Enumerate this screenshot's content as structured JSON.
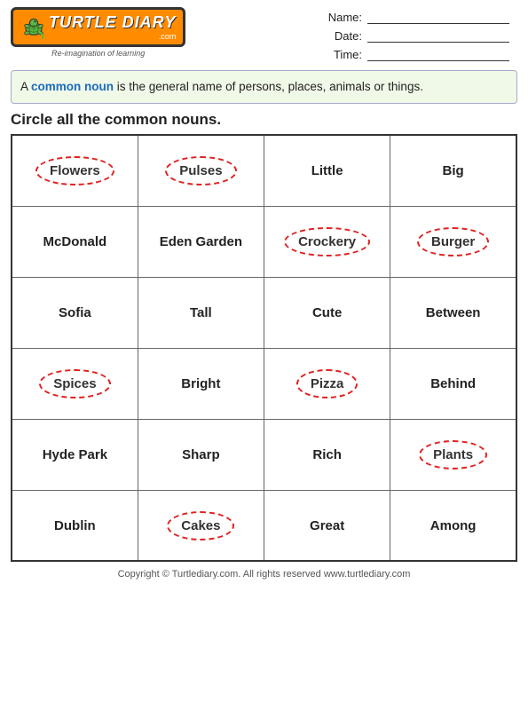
{
  "header": {
    "logo_title": "TURTLE DIARY",
    "logo_subtitle": ".com",
    "logo_reimagine": "Re-imagination of learning",
    "name_label": "Name:",
    "date_label": "Date:",
    "time_label": "Time:"
  },
  "info": {
    "text_before": "A ",
    "link_text": "common noun",
    "text_after": " is the general name of persons, places, animals or things."
  },
  "section_title": "Circle all the common nouns.",
  "grid": [
    [
      {
        "text": "Flowers",
        "circled": true
      },
      {
        "text": "Pulses",
        "circled": true
      },
      {
        "text": "Little",
        "circled": false
      },
      {
        "text": "Big",
        "circled": false
      }
    ],
    [
      {
        "text": "McDonald",
        "circled": false
      },
      {
        "text": "Eden Garden",
        "circled": false
      },
      {
        "text": "Crockery",
        "circled": true
      },
      {
        "text": "Burger",
        "circled": true
      }
    ],
    [
      {
        "text": "Sofia",
        "circled": false
      },
      {
        "text": "Tall",
        "circled": false
      },
      {
        "text": "Cute",
        "circled": false
      },
      {
        "text": "Between",
        "circled": false
      }
    ],
    [
      {
        "text": "Spices",
        "circled": true
      },
      {
        "text": "Bright",
        "circled": false
      },
      {
        "text": "Pizza",
        "circled": true
      },
      {
        "text": "Behind",
        "circled": false
      }
    ],
    [
      {
        "text": "Hyde Park",
        "circled": false
      },
      {
        "text": "Sharp",
        "circled": false
      },
      {
        "text": "Rich",
        "circled": false
      },
      {
        "text": "Plants",
        "circled": true
      }
    ],
    [
      {
        "text": "Dublin",
        "circled": false
      },
      {
        "text": "Cakes",
        "circled": true
      },
      {
        "text": "Great",
        "circled": false
      },
      {
        "text": "Among",
        "circled": false
      }
    ]
  ],
  "footer": "Copyright © Turtlediary.com. All rights reserved  www.turtlediary.com"
}
